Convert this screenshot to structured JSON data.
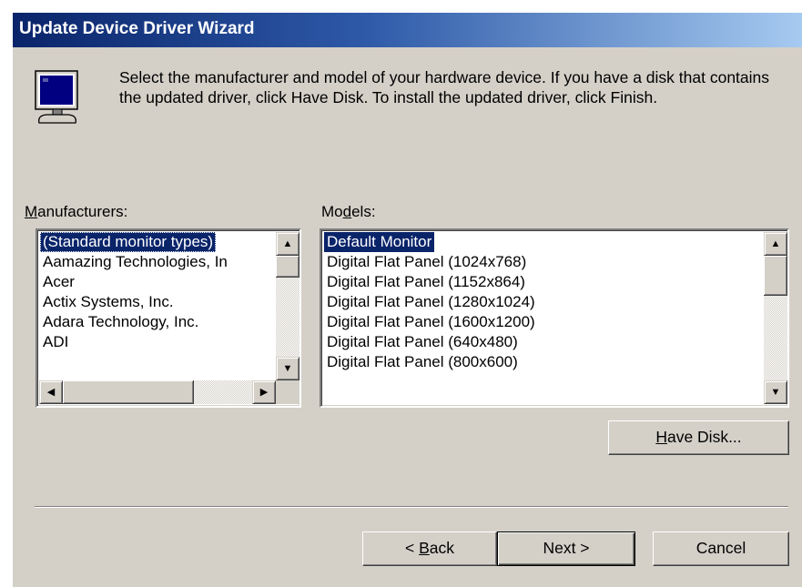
{
  "window": {
    "title": "Update Device Driver Wizard"
  },
  "intro": {
    "text": "Select the manufacturer and model of your hardware device. If you have a disk that contains the updated driver, click Have Disk. To install the updated driver, click Finish."
  },
  "manufacturers": {
    "label_mnemonic": "M",
    "label_rest": "anufacturers:",
    "items": [
      "(Standard monitor types)",
      "Aamazing Technologies, In",
      "Acer",
      "Actix Systems, Inc.",
      "Adara Technology, Inc.",
      "ADI"
    ],
    "selected_index": 0
  },
  "models": {
    "label_pre": "Mo",
    "label_mnemonic": "d",
    "label_rest": "els:",
    "items": [
      "Default Monitor",
      "Digital Flat Panel (1024x768)",
      "Digital Flat Panel (1152x864)",
      "Digital Flat Panel (1280x1024)",
      "Digital Flat Panel (1600x1200)",
      "Digital Flat Panel (640x480)",
      "Digital Flat Panel (800x600)"
    ],
    "selected_index": 0
  },
  "buttons": {
    "have_disk_mnemonic": "H",
    "have_disk_rest": "ave Disk...",
    "back_pre": "< ",
    "back_mnemonic": "B",
    "back_rest": "ack",
    "next": "Next >",
    "cancel": "Cancel"
  },
  "icons": {
    "monitor": "monitor-icon",
    "up": "scroll-up-arrow-icon",
    "down": "scroll-down-arrow-icon",
    "left": "scroll-left-arrow-icon",
    "right": "scroll-right-arrow-icon"
  },
  "colors": {
    "face": "#d4d0c8",
    "title_start": "#0a246a",
    "title_end": "#a6caf0",
    "selection": "#0a246a"
  }
}
